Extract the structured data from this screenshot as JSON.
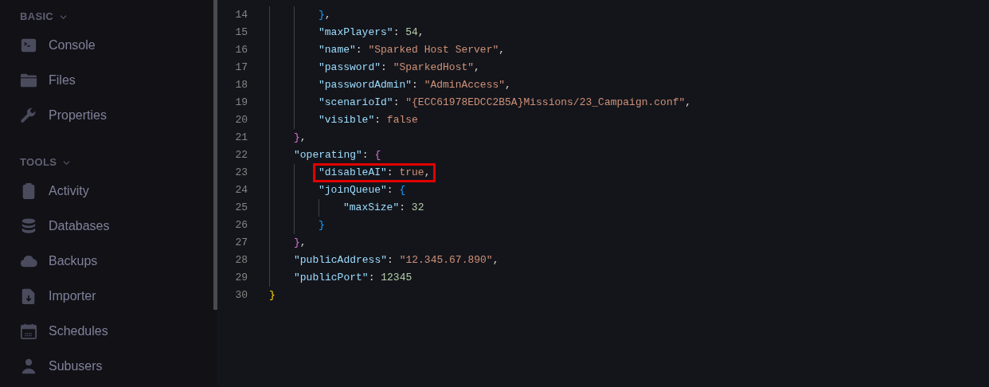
{
  "sidebar": {
    "sections": [
      {
        "title": "BASIC",
        "expanded": true,
        "items": [
          {
            "label": "Console",
            "kind": "console"
          },
          {
            "label": "Files",
            "kind": "folder"
          },
          {
            "label": "Properties",
            "kind": "wrench"
          }
        ]
      },
      {
        "title": "TOOLS",
        "expanded": true,
        "items": [
          {
            "label": "Activity",
            "kind": "clipboard"
          },
          {
            "label": "Databases",
            "kind": "database"
          },
          {
            "label": "Backups",
            "kind": "cloud"
          },
          {
            "label": "Importer",
            "kind": "import"
          },
          {
            "label": "Schedules",
            "kind": "calendar"
          },
          {
            "label": "Subusers",
            "kind": "user"
          }
        ]
      }
    ]
  },
  "editor": {
    "lines": [
      {
        "children": [
          {
            "children": [
              {
                "number": "14",
                "highlighted": false,
                "tokens": [
                  {
                    "kind": "bracket",
                    "text": "}",
                    "color": "#179fff"
                  },
                  {
                    "kind": "punct",
                    "text": ","
                  }
                ]
              },
              {
                "number": "15",
                "highlighted": false,
                "tokens": [
                  {
                    "kind": "key",
                    "text": "\"maxPlayers\""
                  },
                  {
                    "kind": "punct",
                    "text": ": "
                  },
                  {
                    "kind": "number",
                    "text": "54"
                  },
                  {
                    "kind": "punct",
                    "text": ","
                  }
                ]
              },
              {
                "number": "16",
                "highlighted": false,
                "tokens": [
                  {
                    "kind": "key",
                    "text": "\"name\""
                  },
                  {
                    "kind": "punct",
                    "text": ": "
                  },
                  {
                    "kind": "string",
                    "text": "\"Sparked Host Server\""
                  },
                  {
                    "kind": "punct",
                    "text": ","
                  }
                ]
              },
              {
                "number": "17",
                "highlighted": false,
                "tokens": [
                  {
                    "kind": "key",
                    "text": "\"password\""
                  },
                  {
                    "kind": "punct",
                    "text": ": "
                  },
                  {
                    "kind": "string",
                    "text": "\"SparkedHost\""
                  },
                  {
                    "kind": "punct",
                    "text": ","
                  }
                ]
              },
              {
                "number": "18",
                "highlighted": false,
                "tokens": [
                  {
                    "kind": "key",
                    "text": "\"passwordAdmin\""
                  },
                  {
                    "kind": "punct",
                    "text": ": "
                  },
                  {
                    "kind": "string",
                    "text": "\"AdminAccess\""
                  },
                  {
                    "kind": "punct",
                    "text": ","
                  }
                ]
              },
              {
                "number": "19",
                "highlighted": false,
                "tokens": [
                  {
                    "kind": "key",
                    "text": "\"scenarioId\""
                  },
                  {
                    "kind": "punct",
                    "text": ": "
                  },
                  {
                    "kind": "string",
                    "text": "\"{ECC61978EDCC2B5A}Missions/23_Campaign.conf\""
                  },
                  {
                    "kind": "punct",
                    "text": ","
                  }
                ]
              },
              {
                "number": "20",
                "highlighted": false,
                "tokens": [
                  {
                    "kind": "key",
                    "text": "\"visible\""
                  },
                  {
                    "kind": "punct",
                    "text": ": "
                  },
                  {
                    "kind": "literal",
                    "text": "false"
                  }
                ]
              }
            ]
          },
          {
            "number": "21",
            "highlighted": false,
            "tokens": [
              {
                "kind": "bracket",
                "text": "}",
                "color": "#da70d6"
              },
              {
                "kind": "punct",
                "text": ","
              }
            ]
          },
          {
            "number": "22",
            "highlighted": false,
            "tokens": [
              {
                "kind": "key",
                "text": "\"operating\""
              },
              {
                "kind": "punct",
                "text": ": "
              },
              {
                "kind": "bracket",
                "text": "{",
                "color": "#da70d6"
              }
            ]
          },
          {
            "children": [
              {
                "number": "23",
                "highlighted": true,
                "tokens": [
                  {
                    "kind": "key",
                    "text": "\"disableAI\""
                  },
                  {
                    "kind": "punct",
                    "text": ": "
                  },
                  {
                    "kind": "literal",
                    "text": "true"
                  },
                  {
                    "kind": "punct",
                    "text": ","
                  }
                ]
              },
              {
                "number": "24",
                "highlighted": false,
                "tokens": [
                  {
                    "kind": "key",
                    "text": "\"joinQueue\""
                  },
                  {
                    "kind": "punct",
                    "text": ": "
                  },
                  {
                    "kind": "bracket",
                    "text": "{",
                    "color": "#179fff"
                  }
                ]
              },
              {
                "children": [
                  {
                    "number": "25",
                    "highlighted": false,
                    "tokens": [
                      {
                        "kind": "key",
                        "text": "\"maxSize\""
                      },
                      {
                        "kind": "punct",
                        "text": ": "
                      },
                      {
                        "kind": "number",
                        "text": "32"
                      }
                    ]
                  }
                ]
              },
              {
                "number": "26",
                "highlighted": false,
                "tokens": [
                  {
                    "kind": "bracket",
                    "text": "}",
                    "color": "#179fff"
                  }
                ]
              }
            ]
          },
          {
            "number": "27",
            "highlighted": false,
            "tokens": [
              {
                "kind": "bracket",
                "text": "}",
                "color": "#da70d6"
              },
              {
                "kind": "punct",
                "text": ","
              }
            ]
          },
          {
            "number": "28",
            "highlighted": false,
            "tokens": [
              {
                "kind": "key",
                "text": "\"publicAddress\""
              },
              {
                "kind": "punct",
                "text": ": "
              },
              {
                "kind": "string",
                "text": "\"12.345.67.890\""
              },
              {
                "kind": "punct",
                "text": ","
              }
            ]
          },
          {
            "number": "29",
            "highlighted": false,
            "tokens": [
              {
                "kind": "key",
                "text": "\"publicPort\""
              },
              {
                "kind": "punct",
                "text": ": "
              },
              {
                "kind": "number",
                "text": "12345"
              }
            ]
          }
        ]
      },
      {
        "number": "30",
        "highlighted": false,
        "tokens": [
          {
            "kind": "bracket",
            "text": "}",
            "color": "#ffd700"
          }
        ]
      }
    ]
  }
}
